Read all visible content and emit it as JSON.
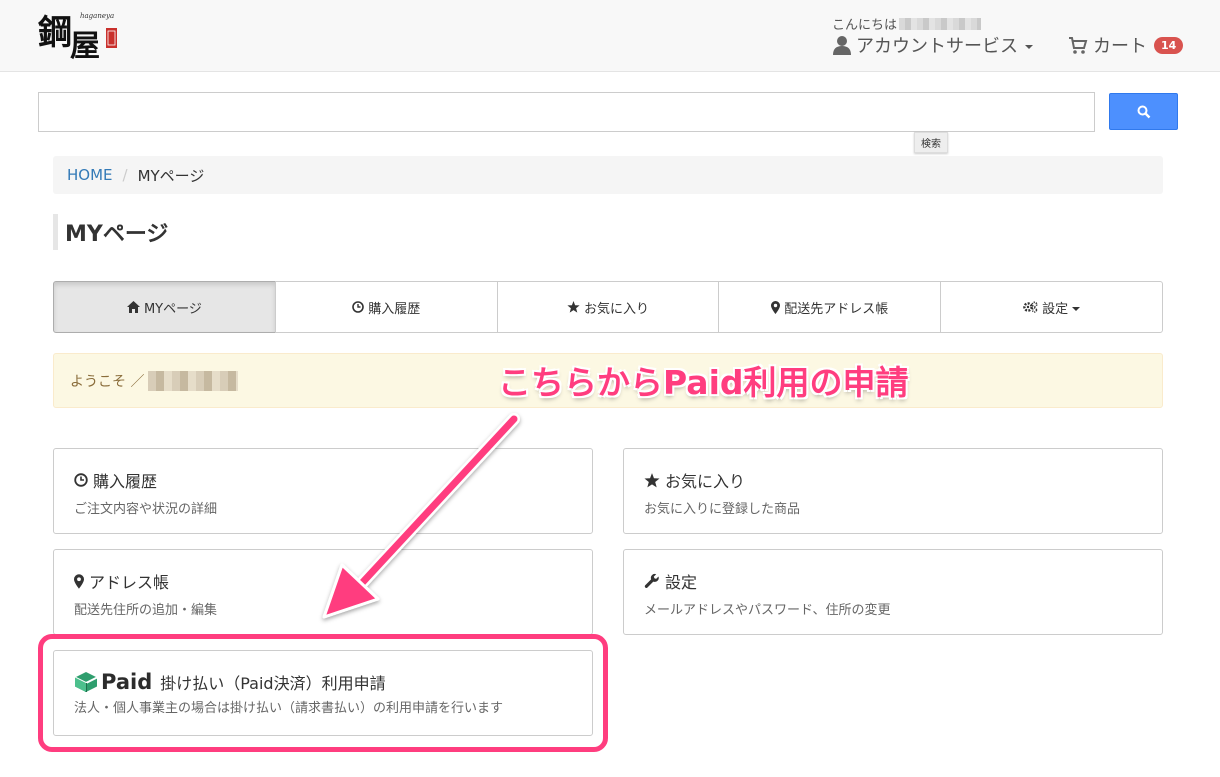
{
  "header": {
    "greeting": "こんにちは",
    "account_label": "アカウントサービス",
    "cart_label": "カート",
    "cart_count": "14",
    "logo_sub": "haganeya"
  },
  "search": {
    "value": "",
    "tooltip": "検索"
  },
  "breadcrumb": {
    "home": "HOME",
    "separator": "/",
    "current": "MYページ"
  },
  "page_title": "MYページ",
  "nav": [
    {
      "label": "MYページ",
      "icon": "home-icon",
      "active": true
    },
    {
      "label": "購入履歴",
      "icon": "clock-icon"
    },
    {
      "label": "お気に入り",
      "icon": "star-icon"
    },
    {
      "label": "配送先アドレス帳",
      "icon": "map-marker-icon"
    },
    {
      "label": "設定",
      "icon": "cogs-icon"
    }
  ],
  "welcome": "ようこそ ／",
  "annotation": "こちらからPaid利用の申請",
  "cards": [
    {
      "title": "購入履歴",
      "desc": "ご注文内容や状況の詳細",
      "icon": "clock-icon"
    },
    {
      "title": "お気に入り",
      "desc": "お気に入りに登録した商品",
      "icon": "star-icon"
    },
    {
      "title": "アドレス帳",
      "desc": "配送先住所の追加・編集",
      "icon": "map-marker-icon"
    },
    {
      "title": "設定",
      "desc": "メールアドレスやパスワード、住所の変更",
      "icon": "wrench-icon"
    },
    {
      "title": "掛け払い（Paid決済）利用申請",
      "desc": "法人・個人事業主の場合は掛け払い（請求書払い）の利用申請を行います",
      "icon": "paid-logo-icon",
      "logo_text": "Paid"
    }
  ],
  "colors": {
    "accent": "#ff3d7f",
    "link": "#337ab7",
    "search_button": "#4d90fe",
    "badge": "#d9534f",
    "paid_green": "#3bb27a"
  }
}
